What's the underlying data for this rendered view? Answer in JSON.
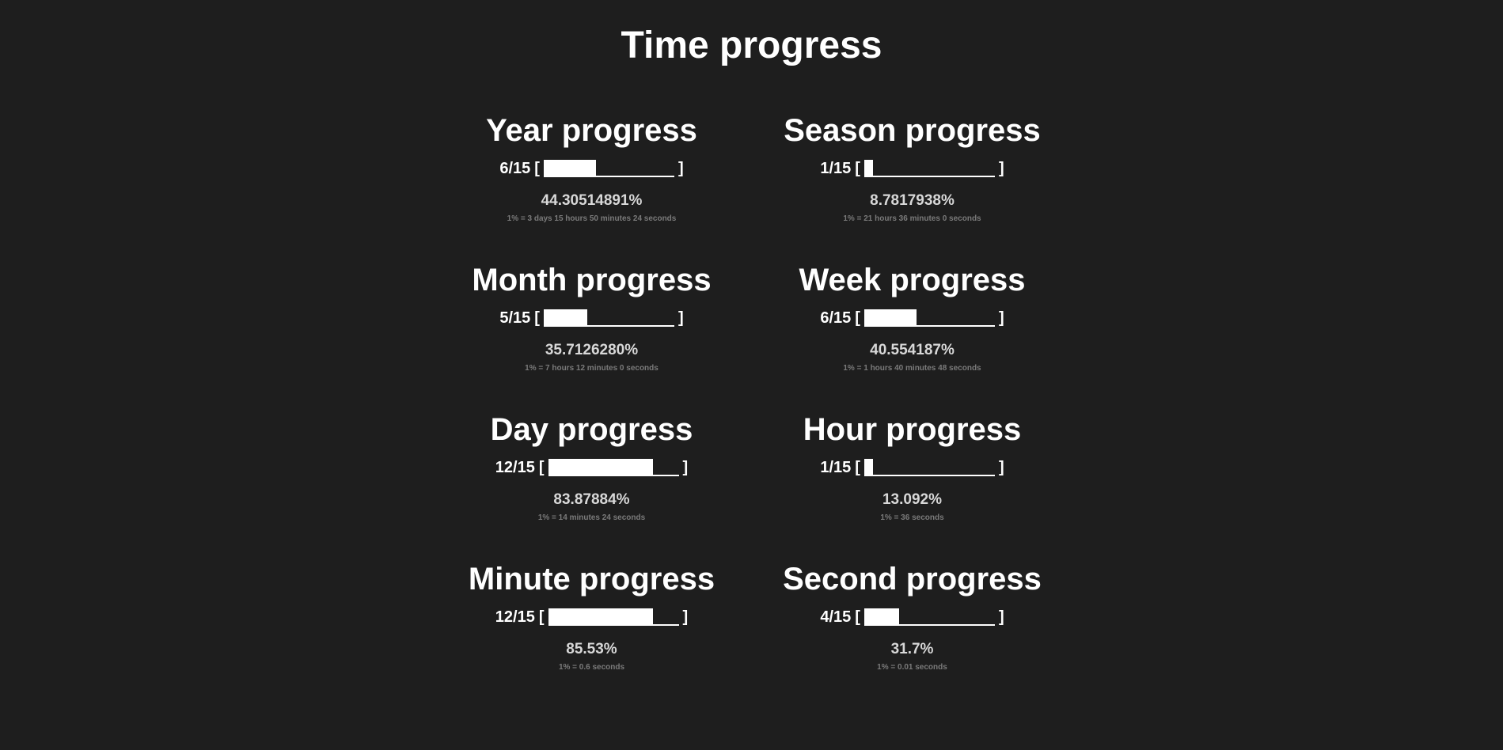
{
  "title": "Time progress",
  "colors": {
    "background": "#1e1e1e",
    "text": "#ffffff",
    "percent": "#d8d8d8",
    "note": "#7a7a7a"
  },
  "bar": {
    "segments": 15,
    "open_bracket": "[",
    "close_bracket": "]"
  },
  "cards": [
    {
      "title": "Year progress",
      "count": "6/15",
      "filled": 6,
      "percent": "44.30514891%",
      "note": "1% = 3 days 15 hours 50 minutes 24 seconds"
    },
    {
      "title": "Season progress",
      "count": "1/15",
      "filled": 1,
      "percent": "8.7817938%",
      "note": "1% = 21 hours 36 minutes 0 seconds"
    },
    {
      "title": "Month progress",
      "count": "5/15",
      "filled": 5,
      "percent": "35.7126280%",
      "note": "1% = 7 hours 12 minutes 0 seconds"
    },
    {
      "title": "Week progress",
      "count": "6/15",
      "filled": 6,
      "percent": "40.554187%",
      "note": "1% = 1 hours 40 minutes 48 seconds"
    },
    {
      "title": "Day progress",
      "count": "12/15",
      "filled": 12,
      "percent": "83.87884%",
      "note": "1% = 14 minutes 24 seconds"
    },
    {
      "title": "Hour progress",
      "count": "1/15",
      "filled": 1,
      "percent": "13.092%",
      "note": "1% = 36 seconds"
    },
    {
      "title": "Minute progress",
      "count": "12/15",
      "filled": 12,
      "percent": "85.53%",
      "note": "1% = 0.6 seconds"
    },
    {
      "title": "Second progress",
      "count": "4/15",
      "filled": 4,
      "percent": "31.7%",
      "note": "1% = 0.01 seconds"
    }
  ]
}
